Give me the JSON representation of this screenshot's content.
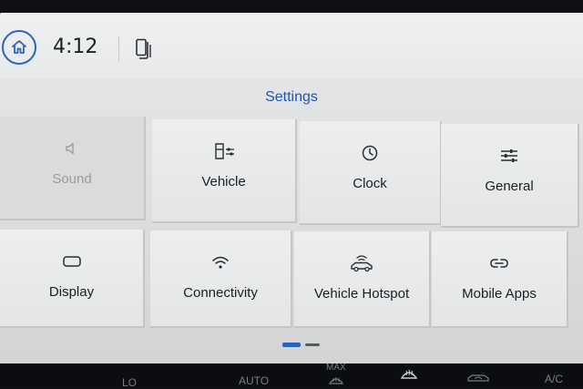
{
  "status_bar": {
    "time": "4:12"
  },
  "page": {
    "title": "Settings"
  },
  "tiles": [
    {
      "label": "Sound",
      "icon": "speaker-icon",
      "disabled": true
    },
    {
      "label": "Vehicle",
      "icon": "vehicle-settings-icon",
      "disabled": false
    },
    {
      "label": "Clock",
      "icon": "clock-icon",
      "disabled": false
    },
    {
      "label": "General",
      "icon": "sliders-icon",
      "disabled": false
    },
    {
      "label": "Display",
      "icon": "display-icon",
      "disabled": false
    },
    {
      "label": "Connectivity",
      "icon": "wifi-icon",
      "disabled": false
    },
    {
      "label": "Vehicle Hotspot",
      "icon": "car-wifi-icon",
      "disabled": false
    },
    {
      "label": "Mobile Apps",
      "icon": "link-icon",
      "disabled": false
    }
  ],
  "pagination": {
    "current": 1,
    "total": 2
  },
  "climate": {
    "lo_label": "LO",
    "auto_label": "AUTO",
    "max_label": "MAX",
    "ac_label": "A/C"
  },
  "colors": {
    "accent": "#2a64b8",
    "tile_bg": "#e8eaeb",
    "text": "#1c1f22",
    "disabled_text": "#9a9c9e"
  }
}
